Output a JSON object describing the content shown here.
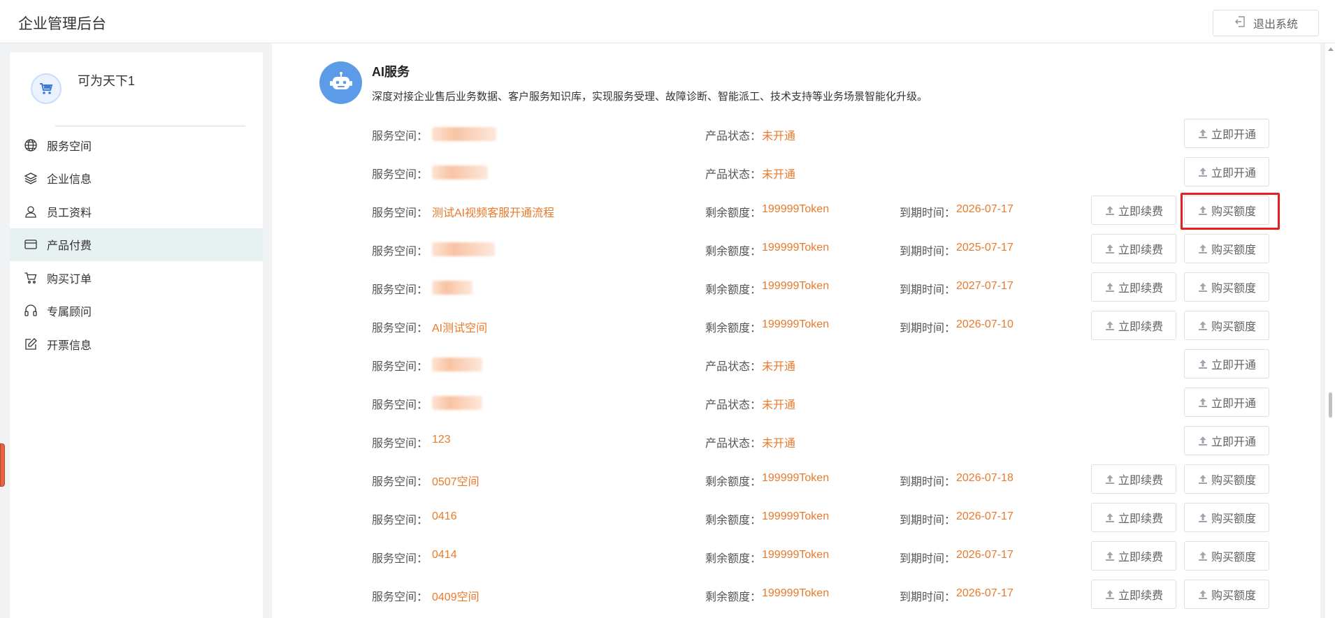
{
  "header": {
    "title": "企业管理后台",
    "logout_label": "退出系统"
  },
  "profile": {
    "company_name": "可为天下1"
  },
  "menu": [
    {
      "label": "服务空间",
      "icon": "globe-icon",
      "active": false
    },
    {
      "label": "企业信息",
      "icon": "layers-icon",
      "active": false
    },
    {
      "label": "员工资料",
      "icon": "user-icon",
      "active": false
    },
    {
      "label": "产品付费",
      "icon": "card-icon",
      "active": true
    },
    {
      "label": "购买订单",
      "icon": "cart-icon",
      "active": false
    },
    {
      "label": "专属顾问",
      "icon": "headset-icon",
      "active": false
    },
    {
      "label": "开票信息",
      "icon": "edit-icon",
      "active": false
    }
  ],
  "service": {
    "title": "AI服务",
    "description": "深度对接企业售后业务数据、客户服务知识库，实现服务受理、故障诊断、智能派工、技术支持等业务场景智能化升级。",
    "space_label": "服务空间：",
    "status_label": "产品状态：",
    "quota_label": "剩余额度：",
    "expiry_label": "到期时间：",
    "rows": [
      {
        "space": "",
        "status": "未开通",
        "quota": "",
        "expiry": "",
        "actions": [
          "立即开通"
        ]
      },
      {
        "space": "",
        "status": "未开通",
        "quota": "",
        "expiry": "",
        "actions": [
          "立即开通"
        ]
      },
      {
        "space": "测试AI视频客服开通流程",
        "status": "",
        "quota": "199999Token",
        "expiry": "2026-07-17",
        "actions": [
          "立即续费",
          "购买额度"
        ]
      },
      {
        "space": "",
        "status": "",
        "quota": "199999Token",
        "expiry": "2025-07-17",
        "actions": [
          "立即续费",
          "购买额度"
        ]
      },
      {
        "space": "",
        "status": "",
        "quota": "199999Token",
        "expiry": "2027-07-17",
        "actions": [
          "立即续费",
          "购买额度"
        ]
      },
      {
        "space": "AI测试空间",
        "status": "",
        "quota": "199999Token",
        "expiry": "2026-07-10",
        "actions": [
          "立即续费",
          "购买额度"
        ]
      },
      {
        "space": "",
        "status": "未开通",
        "quota": "",
        "expiry": "",
        "actions": [
          "立即开通"
        ]
      },
      {
        "space": "",
        "status": "未开通",
        "quota": "",
        "expiry": "",
        "actions": [
          "立即开通"
        ]
      },
      {
        "space": "123",
        "status": "未开通",
        "quota": "",
        "expiry": "",
        "actions": [
          "立即开通"
        ]
      },
      {
        "space": "0507空间",
        "status": "",
        "quota": "199999Token",
        "expiry": "2026-07-18",
        "actions": [
          "立即续费",
          "购买额度"
        ]
      },
      {
        "space": "0416",
        "status": "",
        "quota": "199999Token",
        "expiry": "2026-07-17",
        "actions": [
          "立即续费",
          "购买额度"
        ]
      },
      {
        "space": "0414",
        "status": "",
        "quota": "199999Token",
        "expiry": "2026-07-17",
        "actions": [
          "立即续费",
          "购买额度"
        ]
      },
      {
        "space": "0409空间",
        "status": "",
        "quota": "199999Token",
        "expiry": "2026-07-17",
        "actions": [
          "立即续费",
          "购买额度"
        ]
      }
    ]
  },
  "colors": {
    "accent_orange": "#e87a2b",
    "icon_blue": "#5b9be8",
    "highlight_red": "#e52020",
    "active_menu_bg": "#e8f1f2"
  }
}
